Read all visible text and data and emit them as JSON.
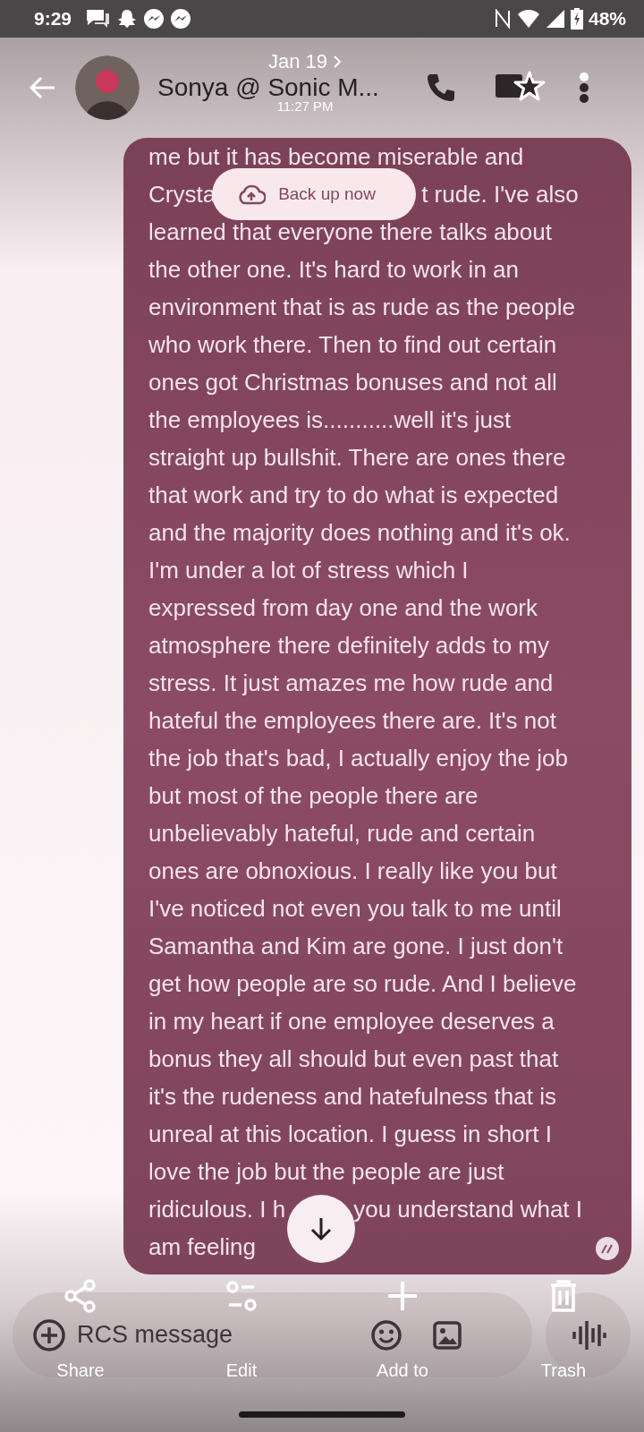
{
  "status_bar": {
    "time": "9:29",
    "battery": "48%"
  },
  "header": {
    "contact_name": "Sonya @ Sonic M...",
    "date": "Jan 19",
    "time": "11:27 PM"
  },
  "backup_chip": {
    "label": "Back up now"
  },
  "message": {
    "lines": [
      {
        "parts": [
          "me but it has become miserable and"
        ]
      },
      {
        "parts": [
          "Crysta",
          "t rude. I've also"
        ],
        "kind": "backup_chip"
      },
      {
        "parts": [
          "learned that everyone there talks about"
        ]
      },
      {
        "parts": [
          "the other one. It's hard to work in an"
        ]
      },
      {
        "parts": [
          "environment that is as rude as the people"
        ]
      },
      {
        "parts": [
          "who work there. Then to find out certain"
        ]
      },
      {
        "parts": [
          "ones got Christmas bonuses and not all"
        ]
      },
      {
        "parts": [
          "the employees is...........well it's just"
        ]
      },
      {
        "parts": [
          "straight up bullshit. There are ones there"
        ]
      },
      {
        "parts": [
          "that work and try to do what is expected"
        ]
      },
      {
        "parts": [
          "and the majority does nothing and it's ok."
        ]
      },
      {
        "parts": [
          "I'm under a lot of stress which I"
        ]
      },
      {
        "parts": [
          "expressed from day one and the work"
        ]
      },
      {
        "parts": [
          "atmosphere there definitely adds to my"
        ]
      },
      {
        "parts": [
          "stress. It just amazes me how rude and"
        ]
      },
      {
        "parts": [
          "hateful the employees there are. It's not"
        ]
      },
      {
        "parts": [
          "the job that's bad, I actually enjoy the job"
        ]
      },
      {
        "parts": [
          "but most of the people there are"
        ]
      },
      {
        "parts": [
          "unbelievably hateful, rude and certain"
        ]
      },
      {
        "parts": [
          "ones are obnoxious. I really like you but"
        ]
      },
      {
        "parts": [
          "I've noticed not even you talk to me until"
        ]
      },
      {
        "parts": [
          "Samantha and Kim are gone. I just don't"
        ]
      },
      {
        "parts": [
          "get how people are so rude. And I believe"
        ]
      },
      {
        "parts": [
          "in my heart if one employee deserves a"
        ]
      },
      {
        "parts": [
          "bonus they all should but even past that"
        ]
      },
      {
        "parts": [
          "it's the rudeness and hatefulness that is"
        ]
      },
      {
        "parts": [
          "unreal at this location. I guess in short I"
        ]
      },
      {
        "parts": [
          "love the job but the people are just"
        ]
      },
      {
        "parts": [
          "ridiculous. I h",
          "you understand what I"
        ],
        "kind": "scroll_button"
      },
      {
        "parts": [
          "am feeling"
        ]
      }
    ]
  },
  "compose": {
    "placeholder": "RCS message"
  },
  "actions": [
    {
      "kind": "share",
      "label": "Share"
    },
    {
      "kind": "edit",
      "label": "Edit"
    },
    {
      "kind": "add",
      "label": "Add to"
    },
    {
      "kind": "trash",
      "label": "Trash"
    }
  ]
}
